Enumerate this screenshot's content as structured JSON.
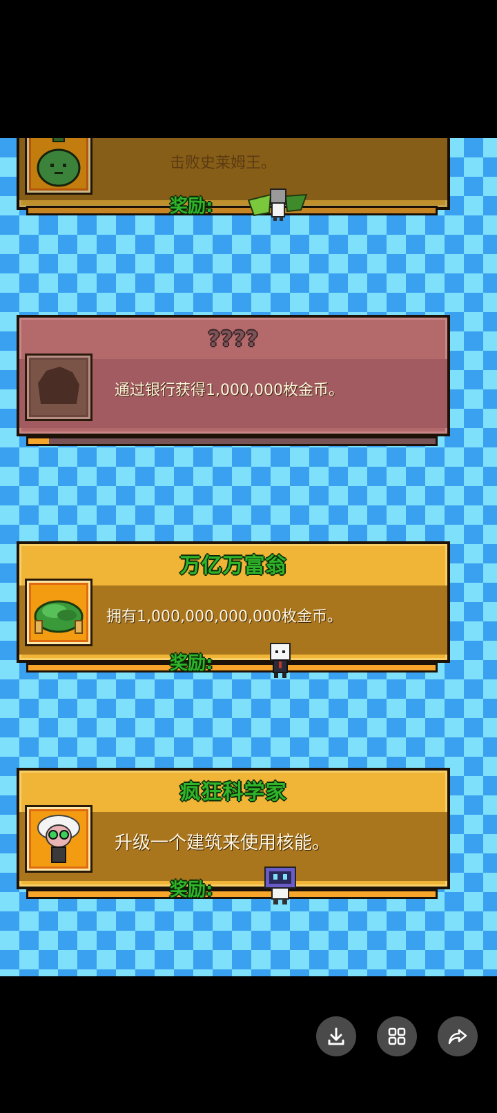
{
  "achievements": [
    {
      "title": "",
      "description": "击败史莱姆王。",
      "reward_label": "奖励:",
      "state": "unlocked",
      "icon": "green-slime-potion-icon"
    },
    {
      "title": "????",
      "description": "通过银行获得1,000,000枚金币。",
      "reward_label": "",
      "state": "locked",
      "progress": 0.05,
      "icon": "locked-silhouette-icon"
    },
    {
      "title": "万亿万富翁",
      "description": "拥有1,000,000,000,000枚金币。",
      "reward_label": "奖励:",
      "state": "unlocked",
      "icon": "cash-pile-icon"
    },
    {
      "title": "疯狂科学家",
      "description": "升级一个建筑来使用核能。",
      "reward_label": "奖励:",
      "state": "unlocked",
      "icon": "mad-scientist-icon"
    }
  ],
  "bottom_actions": [
    {
      "icon": "download-icon"
    },
    {
      "icon": "grid-icon"
    },
    {
      "icon": "share-icon"
    }
  ],
  "colors": {
    "title_green": "#2fb42a",
    "card_gold": "#f0b437",
    "band_brown": "#a9751d",
    "locked_card": "#b46a6a",
    "checker_light": "#7ee0fb",
    "checker_dark": "#3aa0f0"
  }
}
